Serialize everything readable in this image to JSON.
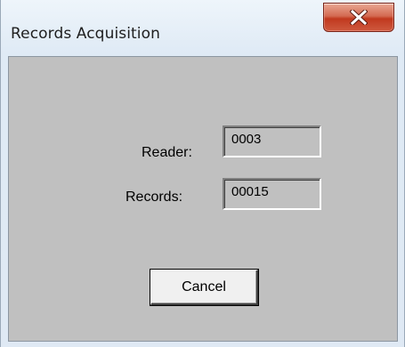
{
  "window": {
    "title": "Records Acquisition"
  },
  "title_bar": {
    "close_icon": "close-x-icon",
    "close_button_color": "#c9462c"
  },
  "form": {
    "reader_label": "Reader:",
    "reader_value": "0003",
    "records_label": "Records:",
    "records_value": "00015"
  },
  "actions": {
    "cancel_label": "Cancel"
  },
  "colors": {
    "dialog_background": "#c0c0c0",
    "title_bar_background": "#dfeaf5"
  }
}
